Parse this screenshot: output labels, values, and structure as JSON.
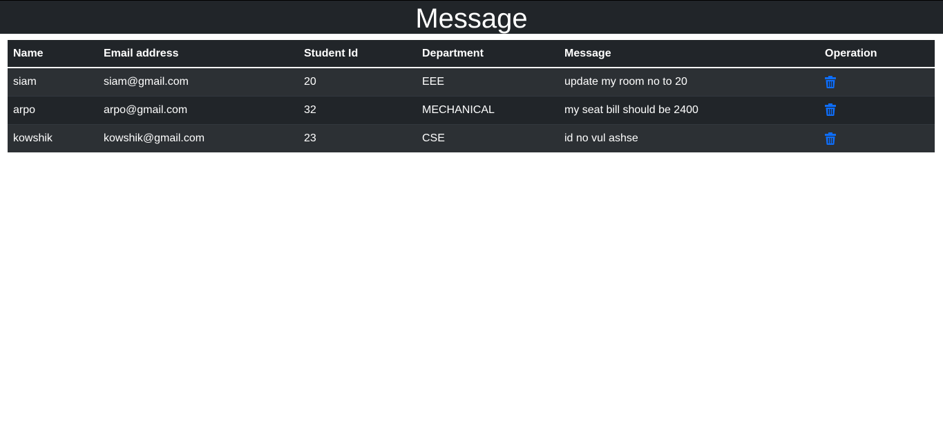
{
  "header": {
    "title": "Message"
  },
  "table": {
    "columns": [
      "Name",
      "Email address",
      "Student Id",
      "Department",
      "Message",
      "Operation"
    ],
    "rows": [
      {
        "name": "siam",
        "email": "siam@gmail.com",
        "student_id": "20",
        "department": "EEE",
        "message": "update my room no to 20",
        "operation_icon": "trash-icon"
      },
      {
        "name": "arpo",
        "email": "arpo@gmail.com",
        "student_id": "32",
        "department": "MECHANICAL",
        "message": "my seat bill should be 2400",
        "operation_icon": "trash-icon"
      },
      {
        "name": "kowshik",
        "email": "kowshik@gmail.com",
        "student_id": "23",
        "department": "CSE",
        "message": "id no vul ashse",
        "operation_icon": "trash-icon"
      }
    ]
  },
  "colors": {
    "header_bg": "#212529",
    "row_odd": "#2c3034",
    "row_even": "#212529",
    "icon": "#0d6efd"
  }
}
